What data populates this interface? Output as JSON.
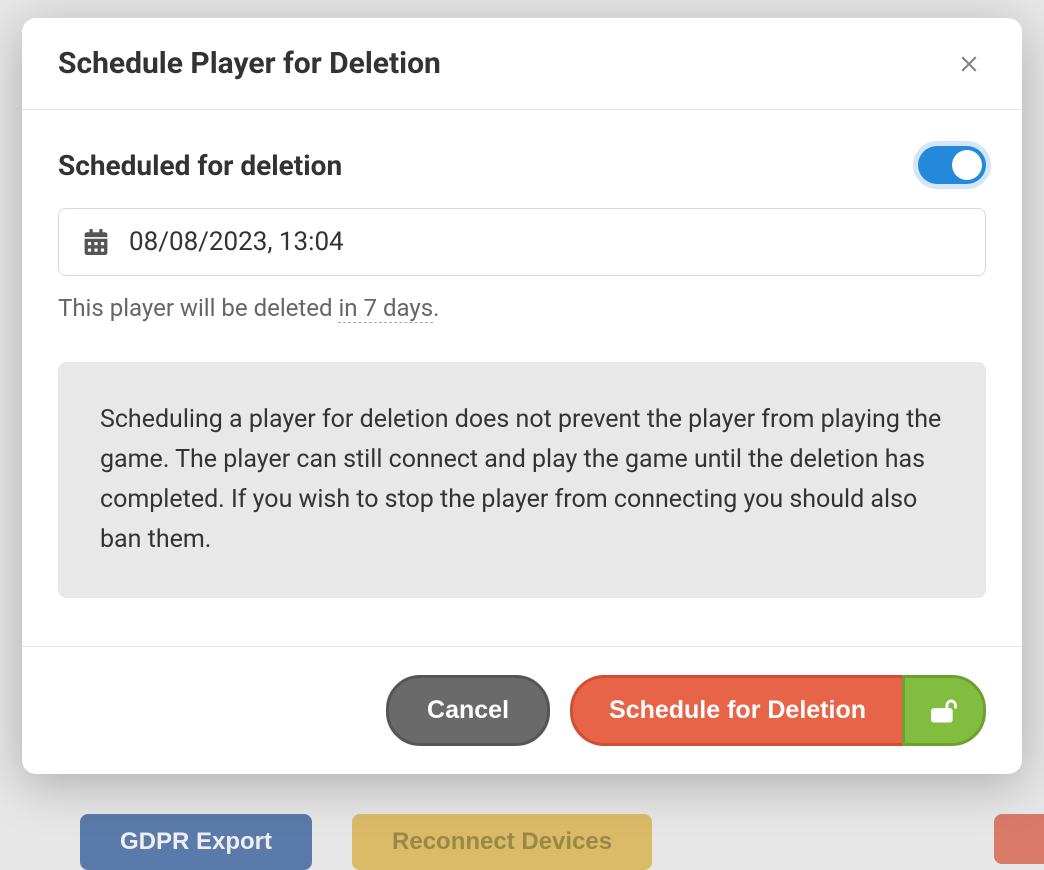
{
  "modal": {
    "title": "Schedule Player for Deletion",
    "toggle_label": "Scheduled for deletion",
    "toggle_on": true,
    "date_value": "08/08/2023, 13:04",
    "helper_prefix": "This player will be deleted ",
    "helper_days": "in 7 days",
    "helper_suffix": ".",
    "info_text": "Scheduling a player for deletion does not prevent the player from playing the game. The player can still connect and play the game until the deletion has completed. If you wish to stop the player from connecting you should also ban them.",
    "cancel_label": "Cancel",
    "submit_label": "Schedule for Deletion"
  },
  "background": {
    "gdpr_label": "GDPR Export",
    "reconnect_label": "Reconnect Devices"
  }
}
